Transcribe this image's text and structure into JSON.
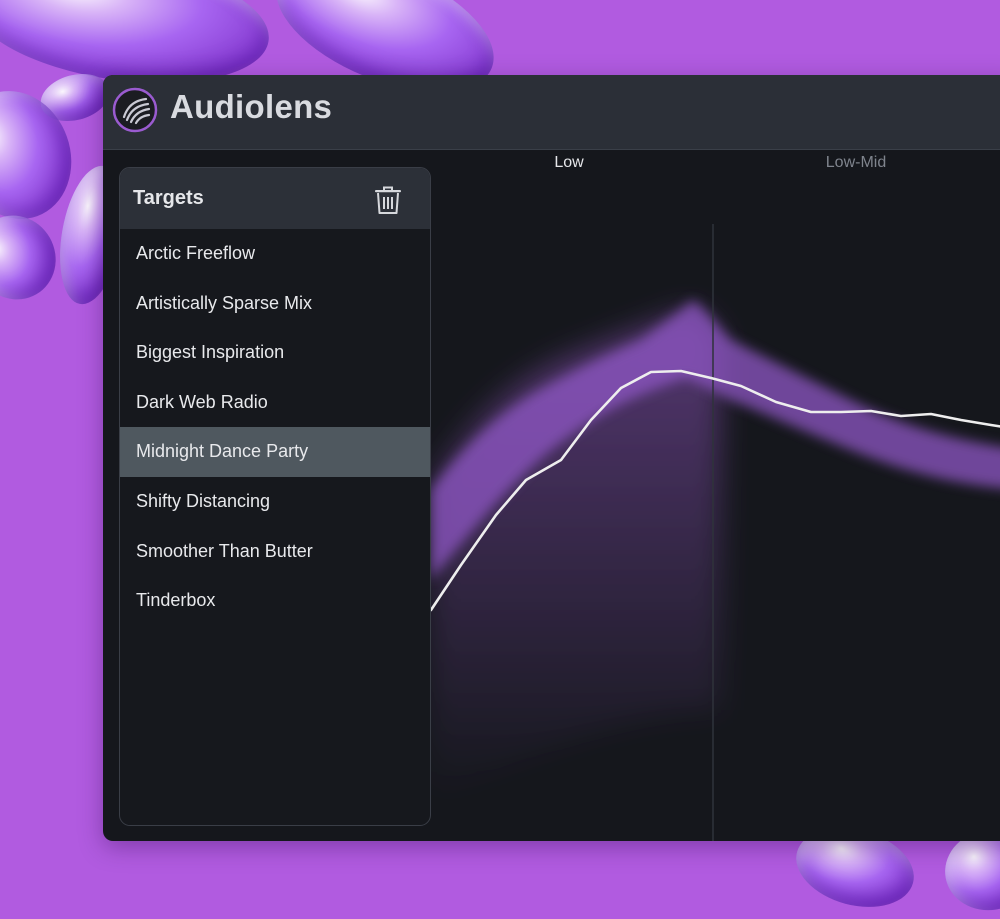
{
  "app": {
    "title": "Audiolens"
  },
  "targets": {
    "title": "Targets",
    "selected_index": 4,
    "items": [
      {
        "label": "Arctic Freeflow"
      },
      {
        "label": "Artistically Sparse Mix"
      },
      {
        "label": "Biggest Inspiration"
      },
      {
        "label": "Dark Web Radio"
      },
      {
        "label": "Midnight Dance Party"
      },
      {
        "label": "Shifty Distancing"
      },
      {
        "label": "Smoother Than Butter"
      },
      {
        "label": "Tinderbox"
      }
    ]
  },
  "graph": {
    "bands": [
      {
        "label": "Low",
        "state": "active"
      },
      {
        "label": "Low-Mid",
        "state": "inactive"
      }
    ]
  },
  "colors": {
    "background": "#b15be0",
    "accent": "#a163d6",
    "curve": "#eeeeee",
    "selected_row": "#4f585f"
  },
  "icons": {
    "logo": "audiolens-logo-icon",
    "delete": "trash-icon"
  }
}
